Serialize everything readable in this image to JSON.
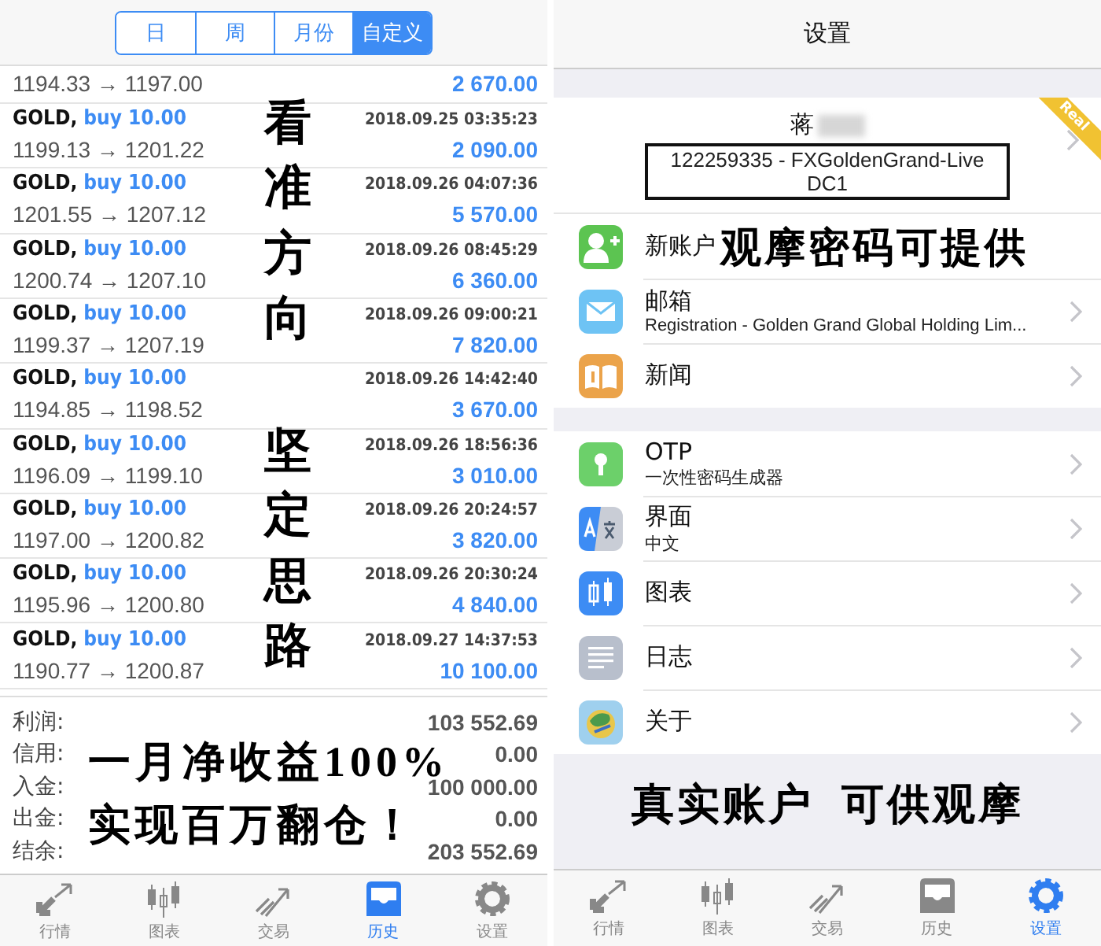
{
  "history": {
    "segments": [
      {
        "label": "日",
        "selected": false
      },
      {
        "label": "周",
        "selected": false
      },
      {
        "label": "月份",
        "selected": false
      },
      {
        "label": "自定义",
        "selected": true
      }
    ],
    "partial_trade": {
      "prices": "1194.33 → 1197.00",
      "profit": "2 670.00"
    },
    "trades": [
      {
        "symbol": "GOLD,",
        "action": "buy 10.00",
        "time": "2018.09.25 03:35:23",
        "prices": "1199.13 → 1201.22",
        "profit": "2 090.00"
      },
      {
        "symbol": "GOLD,",
        "action": "buy 10.00",
        "time": "2018.09.26 04:07:36",
        "prices": "1201.55 → 1207.12",
        "profit": "5 570.00"
      },
      {
        "symbol": "GOLD,",
        "action": "buy 10.00",
        "time": "2018.09.26 08:45:29",
        "prices": "1200.74 → 1207.10",
        "profit": "6 360.00"
      },
      {
        "symbol": "GOLD,",
        "action": "buy 10.00",
        "time": "2018.09.26 09:00:21",
        "prices": "1199.37 → 1207.19",
        "profit": "7 820.00"
      },
      {
        "symbol": "GOLD,",
        "action": "buy 10.00",
        "time": "2018.09.26 14:42:40",
        "prices": "1194.85 → 1198.52",
        "profit": "3 670.00"
      },
      {
        "symbol": "GOLD,",
        "action": "buy 10.00",
        "time": "2018.09.26 18:56:36",
        "prices": "1196.09 → 1199.10",
        "profit": "3 010.00"
      },
      {
        "symbol": "GOLD,",
        "action": "buy 10.00",
        "time": "2018.09.26 20:24:57",
        "prices": "1197.00 → 1200.82",
        "profit": "3 820.00"
      },
      {
        "symbol": "GOLD,",
        "action": "buy 10.00",
        "time": "2018.09.26 20:30:24",
        "prices": "1195.96 → 1200.80",
        "profit": "4 840.00"
      },
      {
        "symbol": "GOLD,",
        "action": "buy 10.00",
        "time": "2018.09.27 14:37:53",
        "prices": "1190.77 → 1200.87",
        "profit": "10 100.00"
      }
    ],
    "summary": [
      {
        "label": "利润:",
        "value": "103 552.69"
      },
      {
        "label": "信用:",
        "value": "0.00"
      },
      {
        "label": "入金:",
        "value": "100 000.00"
      },
      {
        "label": "出金:",
        "value": "0.00"
      },
      {
        "label": "结余:",
        "value": "203 552.69"
      }
    ],
    "tabbar": [
      {
        "kind": "quotes",
        "label": "行情",
        "selected": false
      },
      {
        "kind": "chart",
        "label": "图表",
        "selected": false
      },
      {
        "kind": "trade",
        "label": "交易",
        "selected": false
      },
      {
        "kind": "history",
        "label": "历史",
        "selected": true
      },
      {
        "kind": "settings",
        "label": "设置",
        "selected": false
      }
    ],
    "captions": [
      "看准方向",
      "坚定思路"
    ],
    "slogan": [
      "一月净收益100%",
      "实现百万翻仓！"
    ]
  },
  "settings": {
    "title": "设置",
    "account": {
      "name": "蒋",
      "server": "122259335 - FXGoldenGrand-Live DC1",
      "badge": "Real"
    },
    "groups": [
      [
        {
          "kind": "new-account",
          "label": "新账户",
          "chevron": false
        },
        {
          "kind": "mail",
          "label": "邮箱",
          "sub": "Registration - Golden Grand Global Holding Lim...",
          "chevron": true
        },
        {
          "kind": "news",
          "label": "新闻",
          "chevron": true
        }
      ],
      [
        {
          "kind": "otp",
          "label": "OTP",
          "sub": "一次性密码生成器",
          "chevron": true
        },
        {
          "kind": "interface",
          "label": "界面",
          "sub": "中文",
          "chevron": true
        },
        {
          "kind": "chart",
          "label": "图表",
          "chevron": true
        },
        {
          "kind": "journal",
          "label": "日志",
          "chevron": true
        },
        {
          "kind": "about",
          "label": "关于",
          "chevron": true
        }
      ]
    ],
    "tabbar": [
      {
        "kind": "quotes",
        "label": "行情",
        "selected": false
      },
      {
        "kind": "chart",
        "label": "图表",
        "selected": false
      },
      {
        "kind": "trade",
        "label": "交易",
        "selected": false
      },
      {
        "kind": "history",
        "label": "历史",
        "selected": false
      },
      {
        "kind": "settings",
        "label": "设置",
        "selected": true
      }
    ],
    "overlay_note": "观摩密码可提供",
    "banner": "真实账户  可供观摩"
  }
}
